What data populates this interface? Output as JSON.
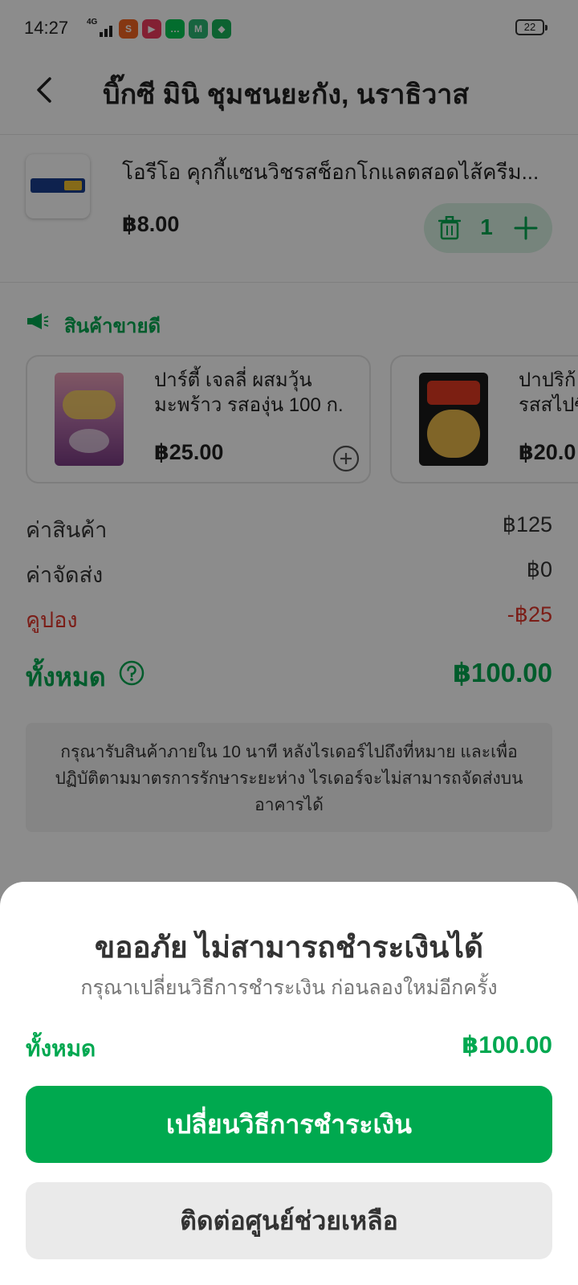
{
  "status_bar": {
    "time": "14:27",
    "network": "4G",
    "battery": "22",
    "app_icons": [
      "shopping-app-icon",
      "video-app-icon",
      "line-chat-icon",
      "maps-app-icon",
      "shield-app-icon"
    ]
  },
  "header": {
    "title": "บิ๊กซี มินิ ชุมชนยะกัง, นราธิวาส",
    "back_icon": "chevron-left-icon"
  },
  "cart_item": {
    "name": "โอรีโอ คุกกี้แซนวิชรสช็อกโกแลตสอดไส้ครีม...",
    "price": "฿8.00",
    "quantity": "1"
  },
  "best_sellers": {
    "title": "สินค้าขายดี",
    "items": [
      {
        "name_lines": [
          "ปาร์ตี้ เจลลี่ ผสมวุ้น",
          "มะพร้าว รสองุ่น 100 ก."
        ],
        "price": "฿25.00"
      },
      {
        "name_lines": [
          "ปาปริก้",
          "รสสไปซี"
        ],
        "price": "฿20.0"
      }
    ]
  },
  "summary": {
    "subtotal_label": "ค่าสินค้า",
    "subtotal_value": "฿125",
    "delivery_label": "ค่าจัดส่ง",
    "delivery_value": "฿0",
    "coupon_label": "คูปอง",
    "coupon_value": "-฿25",
    "total_label": "ทั้งหมด",
    "total_value": "฿100.00"
  },
  "notice": {
    "lines": [
      "กรุณารับสินค้าภายใน 10 นาที หลังไรเดอร์ไปถึงที่หมาย และเพื่อ",
      "ปฏิบัติตามมาตรการรักษาระยะห่าง ไรเดอร์จะไม่สามารถจัดส่งบน",
      "อาคารได้"
    ]
  },
  "dialog": {
    "title": "ขออภัย ไม่สามารถชำระเงินได้",
    "subtitle": "กรุณาเปลี่ยนวิธีการชำระเงิน ก่อนลองใหม่อีกครั้ง",
    "total_label": "ทั้งหมด",
    "total_value": "฿100.00",
    "primary_button": "เปลี่ยนวิธีการชำระเงิน",
    "secondary_button": "ติดต่อศูนย์ช่วยเหลือ"
  },
  "colors": {
    "brand_green": "#00a94f",
    "coupon_red": "#e0352b",
    "overlay": "rgba(0,0,0,0.45)"
  }
}
